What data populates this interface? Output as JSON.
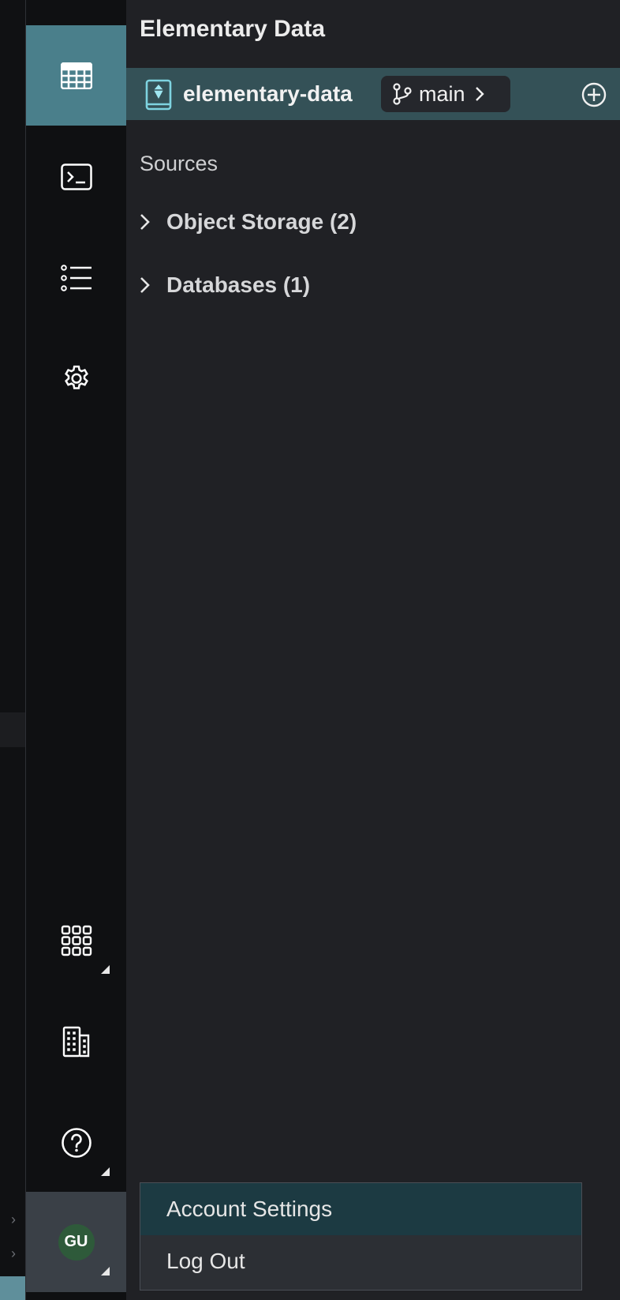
{
  "app": {
    "title": "Elementary Data"
  },
  "repo": {
    "name": "elementary-data",
    "branch": "main"
  },
  "explorer": {
    "section_label": "Sources",
    "items": [
      {
        "label": "Object Storage (2)"
      },
      {
        "label": "Databases (1)"
      }
    ]
  },
  "user": {
    "initials": "GU"
  },
  "account_menu": {
    "items": [
      {
        "label": "Account Settings"
      },
      {
        "label": "Log Out"
      }
    ]
  },
  "colors": {
    "rail_active": "#4a7f8b",
    "repo_bar": "#345157",
    "menu_hover": "#1c3a42",
    "avatar_bg": "#2e5a3a"
  }
}
